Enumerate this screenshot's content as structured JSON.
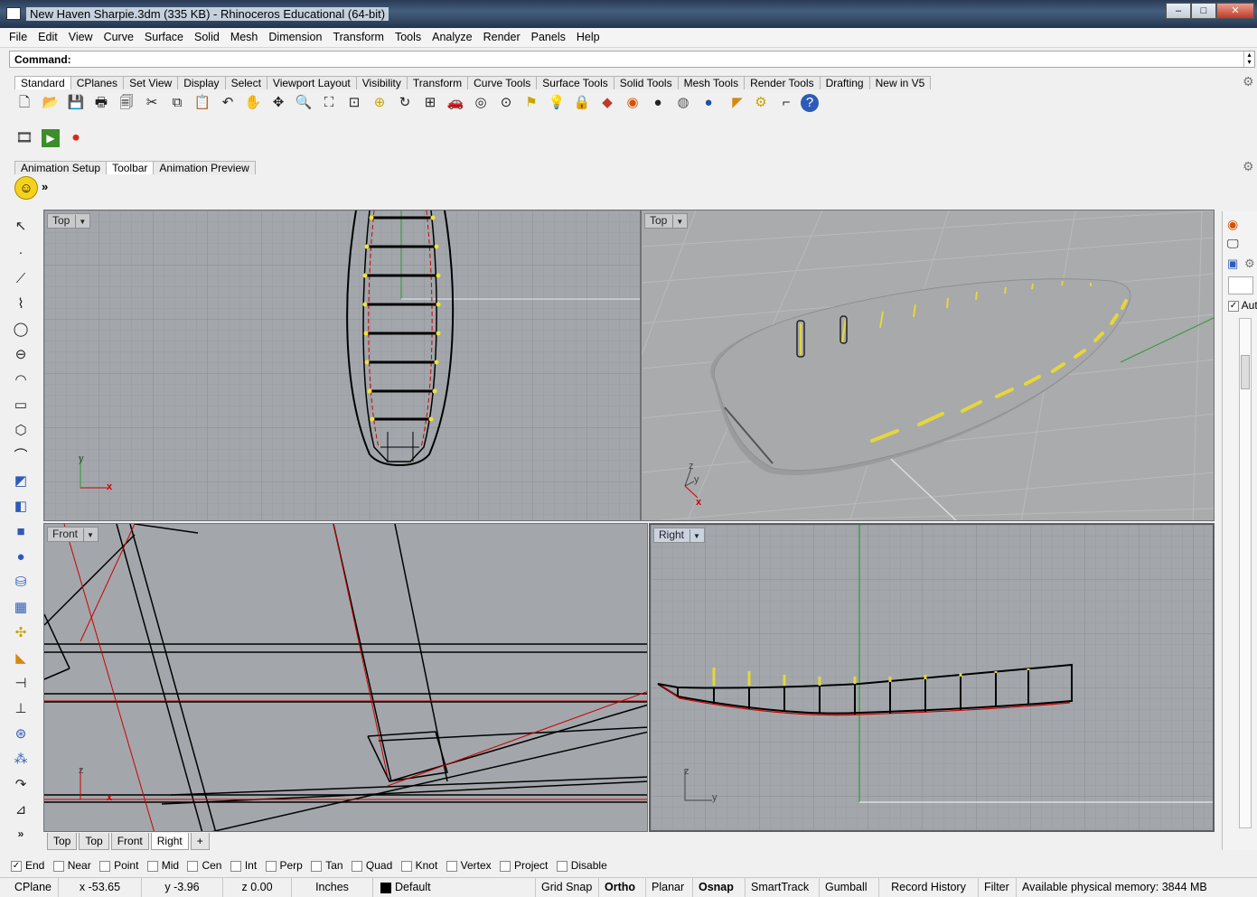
{
  "window": {
    "title": "New Haven Sharpie.3dm (335 KB) - Rhinoceros Educational (64-bit)",
    "min": "–",
    "max": "□",
    "close": "✕"
  },
  "menu": [
    "File",
    "Edit",
    "View",
    "Curve",
    "Surface",
    "Solid",
    "Mesh",
    "Dimension",
    "Transform",
    "Tools",
    "Analyze",
    "Render",
    "Panels",
    "Help"
  ],
  "command": {
    "label": "Command:"
  },
  "toolbar_tabs": [
    "Standard",
    "CPlanes",
    "Set View",
    "Display",
    "Select",
    "Viewport Layout",
    "Visibility",
    "Transform",
    "Curve Tools",
    "Surface Tools",
    "Solid Tools",
    "Mesh Tools",
    "Render Tools",
    "Drafting",
    "New in V5"
  ],
  "toolbar_icons": [
    "new-file-icon",
    "open-icon",
    "save-icon",
    "print-icon",
    "import-icon",
    "cut-icon",
    "copy-icon",
    "paste-icon",
    "undo-icon",
    "pan-icon",
    "rotate-view-icon",
    "zoom-icon",
    "zoom-window-icon",
    "zoom-extents-icon",
    "zoom-selected-icon",
    "rotate-icon",
    "four-view-icon",
    "car-icon",
    "shade-icon",
    "cplane-icon",
    "snap-icon",
    "light-icon",
    "lock-icon",
    "layer-icon",
    "color-wheel-icon",
    "material-icon",
    "render-sphere-icon",
    "render-blue-icon",
    "flag-icon",
    "settings-icon",
    "dimension-icon",
    "help-icon"
  ],
  "animation_tabs": [
    "Animation Setup",
    "Toolbar",
    "Animation Preview"
  ],
  "viewports": {
    "top_left": {
      "label": "Top"
    },
    "top_right": {
      "label": "Top"
    },
    "bottom_left": {
      "label": "Front"
    },
    "bottom_right": {
      "label": "Right"
    }
  },
  "axes": {
    "x": "x",
    "y": "y",
    "z": "z"
  },
  "view_tabs": [
    "Top",
    "Top",
    "Front",
    "Right"
  ],
  "add_tab": "+",
  "osnaps": [
    {
      "label": "End",
      "checked": true
    },
    {
      "label": "Near",
      "checked": false
    },
    {
      "label": "Point",
      "checked": false
    },
    {
      "label": "Mid",
      "checked": false
    },
    {
      "label": "Cen",
      "checked": false
    },
    {
      "label": "Int",
      "checked": false
    },
    {
      "label": "Perp",
      "checked": false
    },
    {
      "label": "Tan",
      "checked": false
    },
    {
      "label": "Quad",
      "checked": false
    },
    {
      "label": "Knot",
      "checked": false
    },
    {
      "label": "Vertex",
      "checked": false
    },
    {
      "label": "Project",
      "checked": false
    },
    {
      "label": "Disable",
      "checked": false
    }
  ],
  "status": {
    "cplane": "CPlane",
    "x": "x -53.65",
    "y": "y -3.96",
    "z": "z 0.00",
    "units": "Inches",
    "layer": "Default",
    "grid_snap": "Grid Snap",
    "ortho": "Ortho",
    "planar": "Planar",
    "osnap": "Osnap",
    "smarttrack": "SmartTrack",
    "gumball": "Gumball",
    "record_history": "Record History",
    "filter": "Filter",
    "memory": "Available physical memory: 3844 MB"
  },
  "right_panel": {
    "auto": "Auto"
  },
  "more": "»"
}
